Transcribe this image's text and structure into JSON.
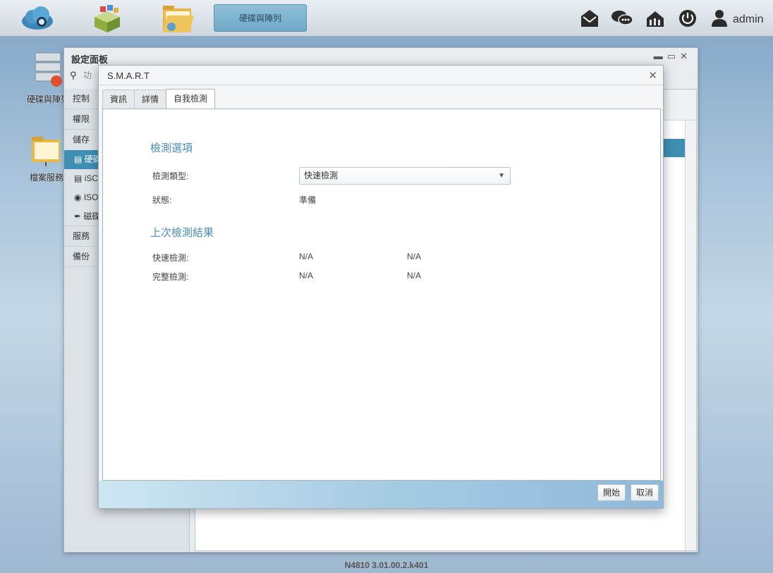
{
  "taskbar": {
    "active_task": "硬碟與陣列",
    "user": "admin",
    "icons": [
      "cloud-logo-icon",
      "app-store-icon",
      "file-folder-icon",
      "mail-icon",
      "chat-icon",
      "network-icon",
      "power-icon",
      "user-icon"
    ]
  },
  "desktop": {
    "items": [
      {
        "label": "硬碟與陣列",
        "icon": "disk-array-icon"
      },
      {
        "label": "檔案服務",
        "icon": "file-service-icon"
      }
    ]
  },
  "settings": {
    "title": "設定面板",
    "search_placeholder": "功",
    "menu": [
      {
        "label": "控制"
      },
      {
        "label": "權限"
      },
      {
        "label": "儲存"
      }
    ],
    "submenu": [
      {
        "label": "硬碟",
        "icon": "disk-icon"
      },
      {
        "label": "iSCSI",
        "icon": "iscsi-icon"
      },
      {
        "label": "ISO",
        "icon": "iso-icon"
      },
      {
        "label": "磁碟",
        "icon": "broom-icon"
      }
    ],
    "menu_after": [
      {
        "label": "服務"
      },
      {
        "label": "備份"
      }
    ]
  },
  "footer": {
    "version": "N4810   3.01.00.2.k401"
  },
  "modal": {
    "title": "S.M.A.R.T",
    "tabs": [
      {
        "label": "資訊"
      },
      {
        "label": "詳情"
      },
      {
        "label": "自我檢測",
        "active": true
      }
    ],
    "test_options": {
      "heading": "檢測選項",
      "type_label": "檢測類型:",
      "type_value": "快速檢測",
      "status_label": "狀態:",
      "status_value": "準備"
    },
    "last_results": {
      "heading": "上次檢測結果",
      "rows": [
        {
          "label": "快速檢測:",
          "col1": "N/A",
          "col2": "N/A"
        },
        {
          "label": "完整檢測:",
          "col1": "N/A",
          "col2": "N/A"
        }
      ]
    },
    "buttons": {
      "start": "開始",
      "cancel": "取消"
    }
  }
}
